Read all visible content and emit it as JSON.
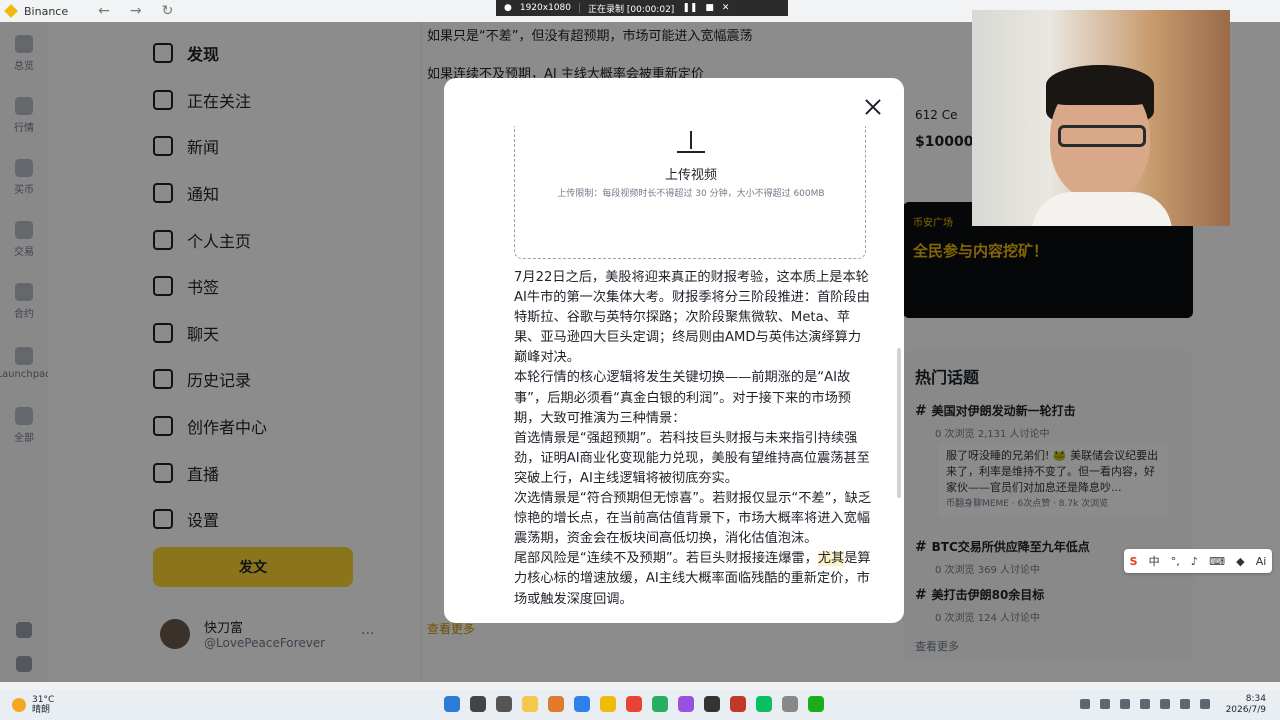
{
  "browser": {
    "title": "Binance",
    "recorder_resolution": "1920x1080",
    "recorder_status": "正在录制 [00:00:02]"
  },
  "rail": {
    "items": [
      {
        "label": "总览"
      },
      {
        "label": "行情"
      },
      {
        "label": "买币"
      },
      {
        "label": "交易"
      },
      {
        "label": "合约"
      },
      {
        "label": "Launchpad"
      },
      {
        "label": "全部"
      }
    ]
  },
  "leftnav": {
    "items": [
      {
        "label": "发现"
      },
      {
        "label": "正在关注"
      },
      {
        "label": "新闻"
      },
      {
        "label": "通知"
      },
      {
        "label": "个人主页"
      },
      {
        "label": "书签"
      },
      {
        "label": "聊天"
      },
      {
        "label": "历史记录"
      },
      {
        "label": "创作者中心"
      },
      {
        "label": "直播"
      },
      {
        "label": "设置"
      }
    ],
    "post_button": "发文",
    "profile_name": "快刀富",
    "profile_handle": "@LovePeaceForever"
  },
  "feed": {
    "line1": "如果只是“不差”，但没有超预期，市场可能进入宽幅震荡",
    "line2": "如果连续不及预期，AI 主线大概率会被重新定价",
    "see_more": "查看更多"
  },
  "right": {
    "price_label": "612 Ce",
    "price_value": "$10000",
    "banner_tag": "币安广场",
    "banner_title": "全民参与内容挖矿！",
    "topics_title": "热门话题",
    "topics": [
      {
        "name": "美国对伊朗发动新一轮打击",
        "meta": "0 次浏览   2,131 人讨论中"
      },
      {
        "name": "BTC交易所供应降至九年低点",
        "meta": "0 次浏览   369 人讨论中"
      },
      {
        "name": "美打击伊朗80余目标",
        "meta": "0 次浏览   124 人讨论中"
      }
    ],
    "topic_card_text": "服了呀没睡的兄弟们! 🐸 美联储会议纪要出来了，利率是维持不变了。但一看内容，好家伙——官员们对加息还是降息吵...",
    "topic_card_meta": "币翻身聊MEME · 6次点赞 · 8.7k 次浏览",
    "see_more": "查看更多"
  },
  "modal": {
    "upload_title": "上传视频",
    "upload_hint": "上传限制：每段视频时长不得超过 30 分钟，大小不得超过 600MB",
    "paragraphs": [
      "7月22日之后，美股将迎来真正的财报考验，这本质上是本轮AI牛市的第一次集体大考。财报季将分三阶段推进：首阶段由特斯拉、谷歌与英特尔探路；次阶段聚焦微软、Meta、苹果、亚马逊四大巨头定调；终局则由AMD与英伟达演绎算力巅峰对决。",
      "本轮行情的核心逻辑将发生关键切换——前期涨的是“AI故事”，后期必须看“真金白银的利润”。对于接下来的市场预期，大致可推演为三种情景：",
      "首选情景是“强超预期”。若科技巨头财报与未来指引持续强劲，证明AI商业化变现能力兑现，美股有望维持高位震荡甚至突破上行，AI主线逻辑将被彻底夯实。",
      "次选情景是“符合预期但无惊喜”。若财报仅显示“不差”，缺乏惊艳的增长点，在当前高估值背景下，市场大概率将进入宽幅震荡期，资金会在板块间高低切换，消化估值泡沫。"
    ],
    "last_paragraph_start": "尾部风险是“连续不及预期”。若巨头财报接连爆雷，",
    "last_paragraph_highlight": "尤其",
    "last_paragraph_end": "是算力核心标的增速放缓，AI主线大概率面临残酷的重新定价，市场或触发深度回调。"
  },
  "ime": {
    "lang": "中"
  },
  "taskbar": {
    "temperature": "31°C",
    "weather": "晴朗",
    "time": "8:34",
    "date": "2026/7/9"
  }
}
